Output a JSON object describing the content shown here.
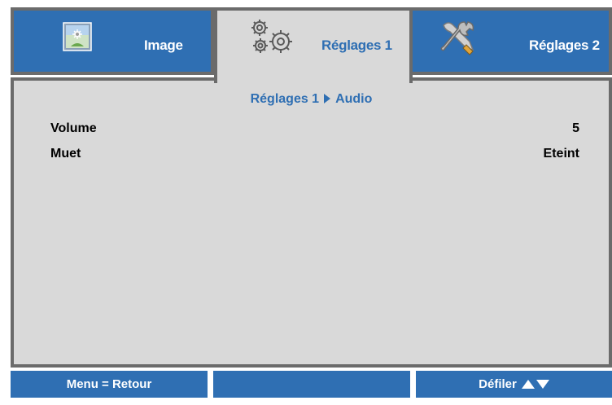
{
  "tabs": {
    "image": {
      "label": "Image",
      "icon": "image-icon"
    },
    "reglages1": {
      "label": "Réglages 1",
      "icon": "gears-icon"
    },
    "reglages2": {
      "label": "Réglages 2",
      "icon": "tools-icon"
    }
  },
  "breadcrumb": {
    "parent": "Réglages 1",
    "current": "Audio"
  },
  "settings": [
    {
      "label": "Volume",
      "value": "5"
    },
    {
      "label": "Muet",
      "value": "Eteint"
    }
  ],
  "footer": {
    "left": "Menu = Retour",
    "middle": "",
    "right": "Défiler"
  },
  "colors": {
    "accent": "#2f6fb3",
    "panel": "#d9d9d9",
    "border": "#6b6b6b"
  }
}
